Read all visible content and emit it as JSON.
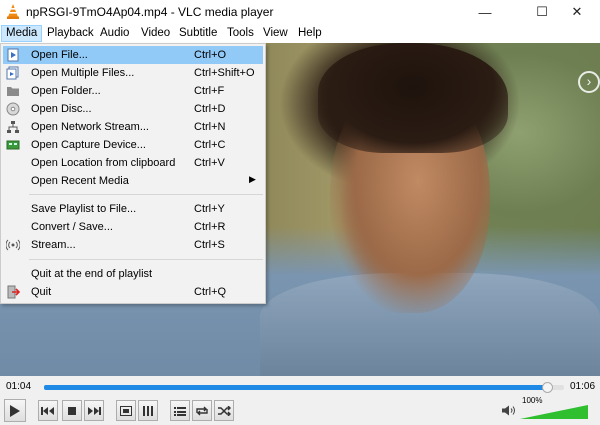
{
  "window": {
    "title": "npRSGI-9TmO4Ap04.mp4 - VLC media player",
    "minimize_glyph": "—",
    "maximize_glyph": "☐",
    "close_glyph": "✕"
  },
  "menubar": {
    "items": [
      "Media",
      "Playback",
      "Audio",
      "Video",
      "Subtitle",
      "Tools",
      "View",
      "Help"
    ],
    "active": "Media"
  },
  "media_menu": {
    "items": [
      {
        "label": "Open File...",
        "shortcut": "Ctrl+O",
        "icon": "open-file-icon",
        "highlighted": true
      },
      {
        "label": "Open Multiple Files...",
        "shortcut": "Ctrl+Shift+O",
        "icon": "open-multiple-files-icon"
      },
      {
        "label": "Open Folder...",
        "shortcut": "Ctrl+F",
        "icon": "folder-icon"
      },
      {
        "label": "Open Disc...",
        "shortcut": "Ctrl+D",
        "icon": "disc-icon"
      },
      {
        "label": "Open Network Stream...",
        "shortcut": "Ctrl+N",
        "icon": "network-icon"
      },
      {
        "label": "Open Capture Device...",
        "shortcut": "Ctrl+C",
        "icon": "capture-device-icon"
      },
      {
        "label": "Open Location from clipboard",
        "shortcut": "Ctrl+V",
        "icon": ""
      },
      {
        "label": "Open Recent Media",
        "shortcut": "",
        "icon": "",
        "submenu": true
      },
      {
        "label": "Save Playlist to File...",
        "shortcut": "Ctrl+Y",
        "icon": ""
      },
      {
        "label": "Convert / Save...",
        "shortcut": "Ctrl+R",
        "icon": ""
      },
      {
        "label": "Stream...",
        "shortcut": "Ctrl+S",
        "icon": "stream-icon"
      },
      {
        "label": "Quit at the end of playlist",
        "shortcut": "",
        "icon": ""
      },
      {
        "label": "Quit",
        "shortcut": "Ctrl+Q",
        "icon": "quit-icon"
      }
    ],
    "submenu_arrow": "▶"
  },
  "player": {
    "elapsed": "01:04",
    "total": "01:06",
    "progress_fraction": 0.97,
    "volume_label": "100%",
    "volume_fraction": 1.0
  },
  "colors": {
    "accent": "#1e8ae6",
    "menu_highlight": "#91c9f7",
    "volume_green": "#2fbf2f"
  }
}
